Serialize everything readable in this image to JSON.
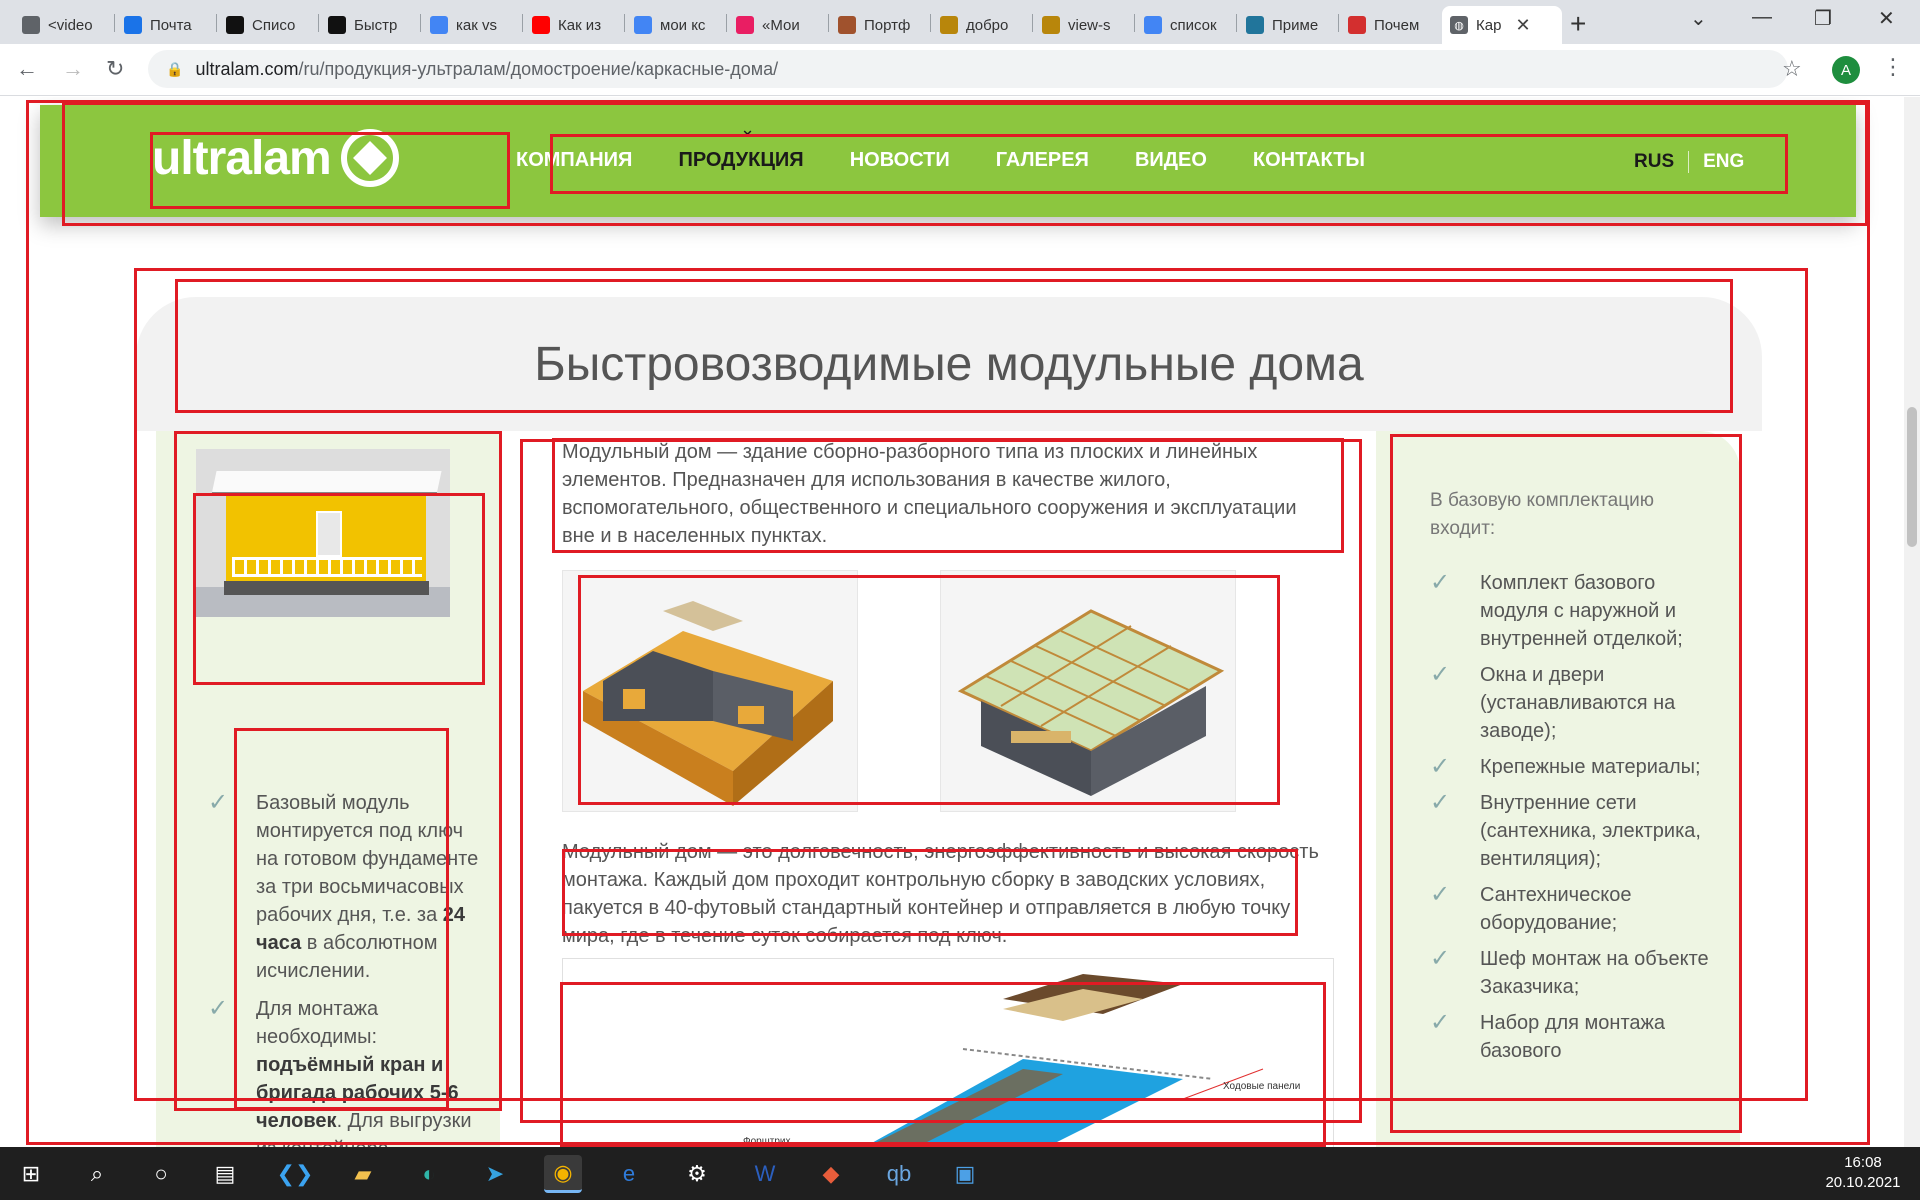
{
  "browser": {
    "tabs": [
      {
        "label": "<video",
        "icon": "chat-icon",
        "color": "#5f6368"
      },
      {
        "label": "Почта",
        "icon": "mail-icon",
        "color": "#1a73e8"
      },
      {
        "label": "Списо",
        "icon": "tb-icon",
        "color": "#111111"
      },
      {
        "label": "Быстр",
        "icon": "chart-icon",
        "color": "#111111"
      },
      {
        "label": "как vs",
        "icon": "google-icon",
        "color": "#4285f4"
      },
      {
        "label": "Как из",
        "icon": "youtube-icon",
        "color": "#ff0000"
      },
      {
        "label": "мои кс",
        "icon": "google-icon",
        "color": "#4285f4"
      },
      {
        "label": "«Мои",
        "icon": "z-icon",
        "color": "#e91e63"
      },
      {
        "label": "Портф",
        "icon": "avatar-icon",
        "color": "#a0522d"
      },
      {
        "label": "добро",
        "icon": "triangle-icon",
        "color": "#b8860b"
      },
      {
        "label": "view-s",
        "icon": "triangle-icon",
        "color": "#b8860b"
      },
      {
        "label": "список",
        "icon": "google-icon",
        "color": "#4285f4"
      },
      {
        "label": "Приме",
        "icon": "wordpress-icon",
        "color": "#21759b"
      },
      {
        "label": "Почем",
        "icon": "grid-icon",
        "color": "#d32f2f"
      }
    ],
    "active_tab": {
      "label": "Кар",
      "icon": "globe-icon"
    },
    "new_tab": "+",
    "url_host": "ultralam.com",
    "url_path": "/ru/продукция-ультралам/домостроение/каркасные-дома/",
    "profile_initial": "A"
  },
  "site": {
    "logo_text": "ultralam",
    "nav": [
      "Компания",
      "Продукция",
      "Новости",
      "Галерея",
      "Видео",
      "Контакты"
    ],
    "nav_current_index": 1,
    "lang_ru": "RUS",
    "lang_en": "ENG",
    "brand_color": "#8cc63f"
  },
  "content": {
    "title": "Быстровозводимые модульные дома",
    "intro": "Модульный дом — здание сборно-разборного типа из плоских и линейных элементов. Предназначен для использования в качестве жилого, вспомогательного, общественного и специального сооружения и эксплуатации вне и в населенных пунктах.",
    "para2": "Модульный дом — это долговечность, энергоэффективность и высокая скорость монтажа. Каждый дом проходит контрольную сборку в заводских условиях, пакуется в 40-футовый стандартный контейнер и отправляется в любую точку мира, где в течение суток собирается под ключ.",
    "diagram_label_1": "Ходовые панели",
    "diagram_label_2": "Форштрих",
    "left_items": [
      {
        "pre": "Базовый модуль монтируется под ключ на готовом фундаменте за три восьмичасовых рабочих дня, т.е. за ",
        "bold": "24 часа",
        "post": " в абсолютном исчислении."
      },
      {
        "pre": "Для монтажа необходимы: ",
        "bold": "подъёмный кран и бригада рабочих 5-6 человек",
        "post": ". Для выгрузки из контейнера —"
      }
    ],
    "right_lead": "В базовую комплектацию входит:",
    "right_items": [
      "Комплект базового модуля с наружной и внутренней отделкой;",
      "Окна и двери (устанавливаются на заводе);",
      "Крепежные материалы;",
      "Внутренние сети (сантехника, электрика, вентиляция);",
      "Сантехническое оборудование;",
      "Шеф монтаж на объекте Заказчика;",
      "Набор для монтажа базового"
    ]
  },
  "taskbar": {
    "time": "16:08",
    "date": "20.10.2021"
  }
}
